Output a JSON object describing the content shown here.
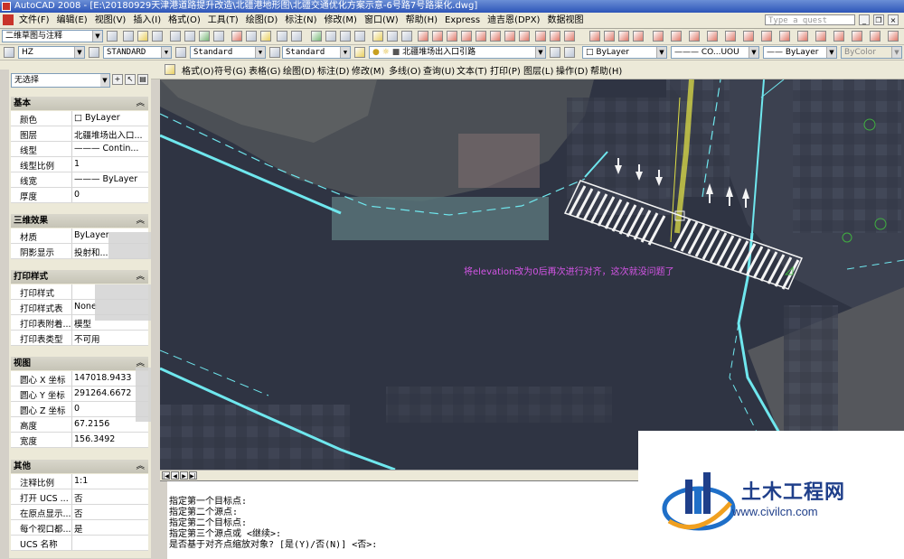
{
  "window": {
    "title": "AutoCAD 2008 - [E:\\20180929天津港道路提升改造\\北疆港地形图\\北疆交通优化方案示意-6号路7号路渠化.dwg]"
  },
  "menubar": {
    "items": [
      "文件(F)",
      "编辑(E)",
      "视图(V)",
      "插入(I)",
      "格式(O)",
      "工具(T)",
      "绘图(D)",
      "标注(N)",
      "修改(M)",
      "窗口(W)",
      "帮助(H)",
      "Express",
      "迪吉恩(DPX)",
      "数据视图"
    ],
    "search_placeholder": "Type a quest"
  },
  "toolbar1": {
    "workspace": "二维草图与注释"
  },
  "toolbar2": {
    "text_style": "HZ",
    "dim_style": "STANDARD",
    "table_style": "Standard",
    "multileader_style": "Standard",
    "layer": "北疆堆场出入口引路",
    "color": "ByLayer",
    "linetype": "CO...UOU",
    "lineweight": "ByLayer",
    "plotstyle": "ByColor"
  },
  "toolbar3": {
    "items": [
      "格式(O)",
      "符号(G)",
      "表格(G)",
      "绘图(D)",
      "标注(D)",
      "修改(M)",
      "多线(O)",
      "查询(U)",
      "文本(T)",
      "打印(P)",
      "图层(L)",
      "操作(D)",
      "帮助(H)"
    ]
  },
  "properties": {
    "selection": "无选择",
    "sections": [
      {
        "title": "基本",
        "rows": [
          {
            "k": "颜色",
            "v": "□ ByLayer"
          },
          {
            "k": "图层",
            "v": "北疆堆场出入口..."
          },
          {
            "k": "线型",
            "v": "——— Contin..."
          },
          {
            "k": "线型比例",
            "v": "1"
          },
          {
            "k": "线宽",
            "v": "——— ByLayer"
          },
          {
            "k": "厚度",
            "v": "0"
          }
        ]
      },
      {
        "title": "三维效果",
        "rows": [
          {
            "k": "材质",
            "v": "ByLayer"
          },
          {
            "k": "阴影显示",
            "v": "投射和..."
          }
        ]
      },
      {
        "title": "打印样式",
        "rows": [
          {
            "k": "打印样式",
            "v": ""
          },
          {
            "k": "打印样式表",
            "v": "None"
          },
          {
            "k": "打印表附着...",
            "v": "模型"
          },
          {
            "k": "打印表类型",
            "v": "不可用"
          }
        ]
      },
      {
        "title": "视图",
        "rows": [
          {
            "k": "圆心 X 坐标",
            "v": "147018.9433"
          },
          {
            "k": "圆心 Y 坐标",
            "v": "291264.6672"
          },
          {
            "k": "圆心 Z 坐标",
            "v": "0"
          },
          {
            "k": "高度",
            "v": "67.2156"
          },
          {
            "k": "宽度",
            "v": "156.3492"
          }
        ]
      },
      {
        "title": "其他",
        "rows": [
          {
            "k": "注释比例",
            "v": "1:1"
          },
          {
            "k": "打开 UCS ...",
            "v": "否"
          },
          {
            "k": "在原点显示...",
            "v": "否"
          },
          {
            "k": "每个视口都...",
            "v": "是"
          },
          {
            "k": "UCS 名称",
            "v": ""
          }
        ]
      }
    ]
  },
  "canvas": {
    "annotation": "将elevation改为0后再次进行对齐，这次就没问题了"
  },
  "command": {
    "lines": [
      "指定第一个目标点:",
      "指定第二个源点:",
      "指定第二个目标点:",
      "指定第三个源点或 <继续>:",
      "是否基于对齐点缩放对象? [是(Y)/否(N)] <否>:"
    ]
  },
  "watermark": {
    "name": "土木工程网",
    "url": "www.civilcn.com"
  }
}
